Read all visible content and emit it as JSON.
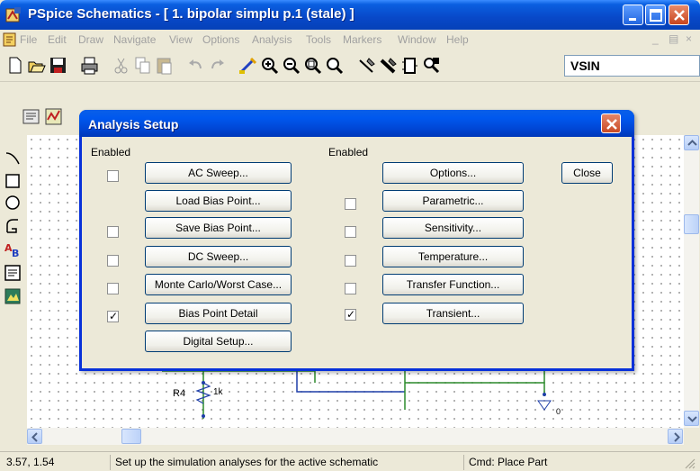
{
  "window": {
    "title": "PSpice Schematics - [ 1. bipolar simplu  p.1 (stale) ]"
  },
  "menu": [
    "File",
    "Edit",
    "Draw",
    "Navigate",
    "View",
    "Options",
    "Analysis",
    "Tools",
    "Markers",
    "Window",
    "Help"
  ],
  "toolbar": {
    "part_name": "VSIN",
    "icons": [
      "new-icon",
      "open-icon",
      "save-icon",
      "print-icon",
      "cut-icon",
      "copy-icon",
      "paste-icon",
      "undo-icon",
      "redo-icon",
      "redraw-icon",
      "zoom-in-icon",
      "zoom-out-icon",
      "zoom-area-icon",
      "zoom-fit-icon",
      "draw-wire-icon",
      "draw-bus-icon",
      "draw-block-icon",
      "get-part-icon"
    ]
  },
  "dialog": {
    "title": "Analysis Setup",
    "enabled_header_left": "Enabled",
    "enabled_header_right": "Enabled",
    "close_label": "Close",
    "left_analyses": [
      {
        "label": "AC Sweep...",
        "enabled": false
      },
      {
        "label": "Load Bias Point...",
        "enabled": null
      },
      {
        "label": "Save Bias Point...",
        "enabled": false
      },
      {
        "label": "DC Sweep...",
        "enabled": false
      },
      {
        "label": "Monte Carlo/Worst Case...",
        "enabled": false
      },
      {
        "label": "Bias Point Detail",
        "enabled": true
      },
      {
        "label": "Digital Setup...",
        "enabled": null
      }
    ],
    "right_analyses": [
      {
        "label": "Options...",
        "enabled": null
      },
      {
        "label": "Parametric...",
        "enabled": false
      },
      {
        "label": "Sensitivity...",
        "enabled": false
      },
      {
        "label": "Temperature...",
        "enabled": false
      },
      {
        "label": "Transfer Function...",
        "enabled": false
      },
      {
        "label": "Transient...",
        "enabled": true
      }
    ]
  },
  "schematic": {
    "resistor_ref": "R4",
    "resistor_value": "1k",
    "ground_label": "0"
  },
  "status": {
    "coords": "3.57, 1.54",
    "message": "Set up the simulation analyses for the active schematic",
    "command": "Cmd: Place Part"
  },
  "colors": {
    "title_bar": "#0A5FE0",
    "dialog_title": "#0046D5",
    "schematic_wire": "#2B8A2B",
    "schematic_wire_blue": "#1F3FA8"
  }
}
